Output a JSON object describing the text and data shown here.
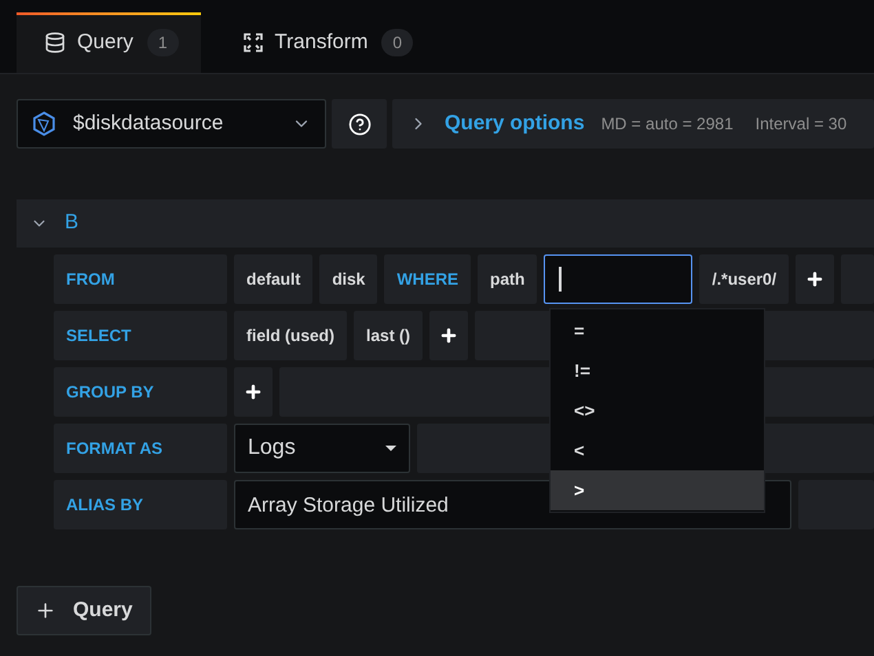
{
  "tabs": [
    {
      "label": "Query",
      "count": "1",
      "selected": true,
      "kind": "database"
    },
    {
      "label": "Transform",
      "count": "0",
      "selected": false,
      "kind": "transform"
    }
  ],
  "datasource": {
    "value": "$diskdatasource"
  },
  "query_options": {
    "label": "Query options",
    "info": [
      "MD = auto = 2981",
      "Interval = 30"
    ]
  },
  "query": {
    "name": "B",
    "expanded": true,
    "rows": [
      {
        "label": "FROM",
        "segments": [
          {
            "kind": "value",
            "text": "default"
          },
          {
            "kind": "value",
            "text": "disk"
          },
          {
            "kind": "keyword",
            "text": "WHERE"
          },
          {
            "kind": "value",
            "text": "path"
          },
          {
            "kind": "input"
          },
          {
            "kind": "value",
            "text": "/.*user0/"
          },
          {
            "kind": "plus"
          },
          {
            "kind": "filler"
          }
        ]
      },
      {
        "label": "SELECT",
        "segments": [
          {
            "kind": "value",
            "text": "field (used)"
          },
          {
            "kind": "value",
            "text": "last ()"
          },
          {
            "kind": "plus"
          },
          {
            "kind": "filler"
          }
        ]
      },
      {
        "label": "GROUP BY",
        "segments": [
          {
            "kind": "plus"
          },
          {
            "kind": "filler"
          }
        ]
      },
      {
        "label": "FORMAT AS",
        "segments": [
          {
            "kind": "select",
            "text": "Logs"
          },
          {
            "kind": "filler"
          }
        ]
      },
      {
        "label": "ALIAS BY",
        "segments": [
          {
            "kind": "text_input",
            "text": "Array Storage Utilized"
          },
          {
            "kind": "filler"
          }
        ]
      }
    ]
  },
  "operator_menu": [
    {
      "label": "=",
      "selected": false
    },
    {
      "label": "!=",
      "selected": false
    },
    {
      "label": "<>",
      "selected": false
    },
    {
      "label": "<",
      "selected": false
    },
    {
      "label": ">",
      "selected": true
    }
  ],
  "add_query_button": {
    "label": "Query"
  }
}
